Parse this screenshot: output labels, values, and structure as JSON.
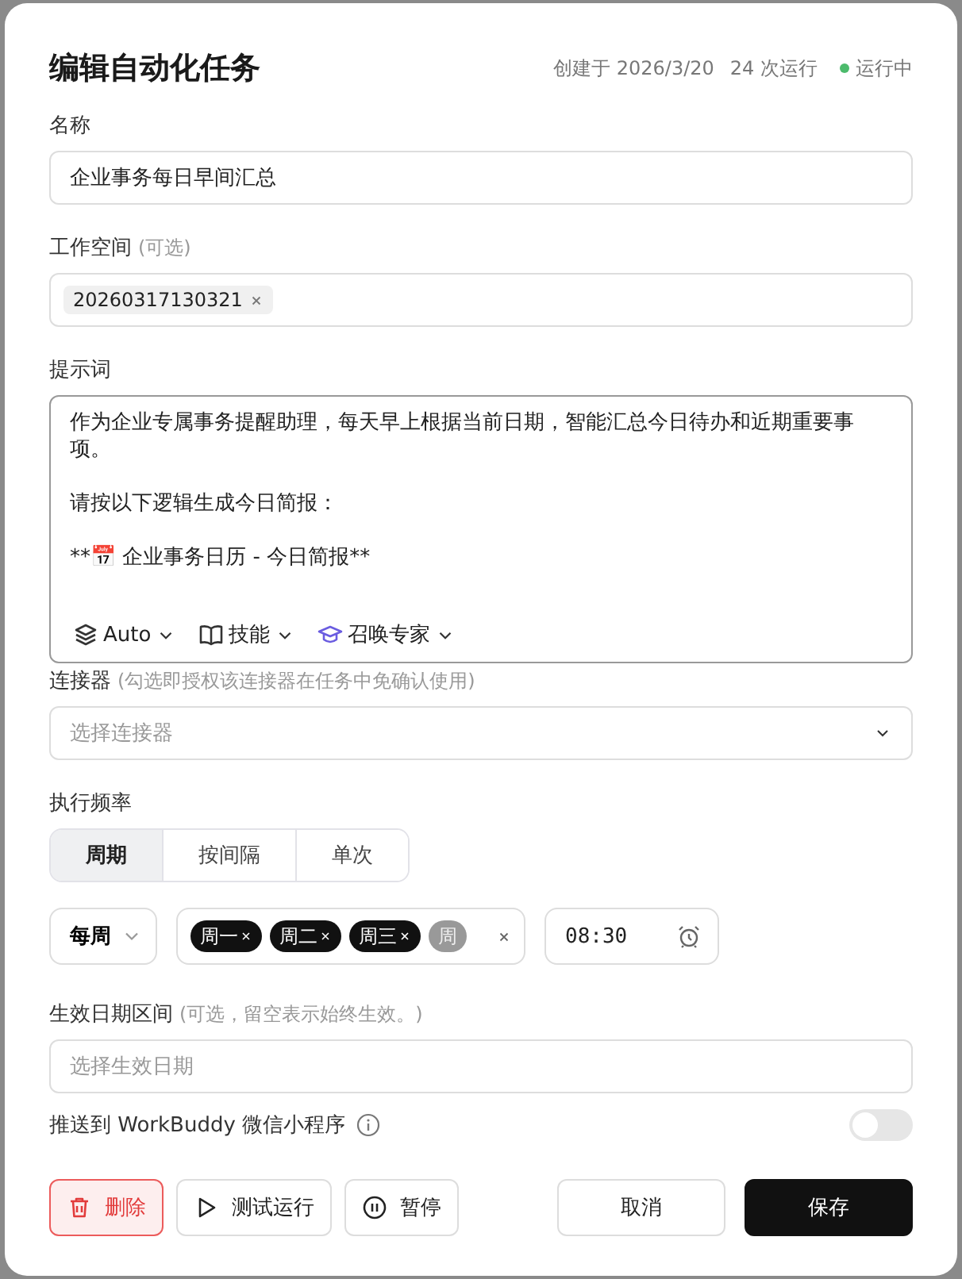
{
  "title": "编辑自动化任务",
  "meta": {
    "created": "创建于 2026/3/20",
    "runs": "24 次运行",
    "status": "运行中"
  },
  "name_field": {
    "label": "名称",
    "value": "企业事务每日早间汇总"
  },
  "workspace": {
    "label": "工作空间",
    "hint": "(可选)",
    "tags": [
      "20260317130321"
    ]
  },
  "prompt": {
    "label": "提示词",
    "paragraphs": [
      "作为企业专属事务提醒助理，每天早上根据当前日期，智能汇总今日待办和近期重要事项。",
      "请按以下逻辑生成今日简报：",
      "**📅 企业事务日历 - 今日简报**"
    ],
    "tools": [
      {
        "kind": "layers",
        "label": "Auto"
      },
      {
        "kind": "book",
        "label": "技能"
      },
      {
        "kind": "expert",
        "label": "召唤专家"
      }
    ]
  },
  "connector": {
    "label": "连接器",
    "hint": "(勾选即授权该连接器在任务中免确认使用)",
    "placeholder": "选择连接器"
  },
  "frequency": {
    "label": "执行频率",
    "tabs": [
      {
        "label": "周期",
        "selected": true
      },
      {
        "label": "按间隔",
        "selected": false
      },
      {
        "label": "单次",
        "selected": false
      }
    ],
    "period": "每周",
    "days": [
      {
        "label": "周一",
        "faded": false
      },
      {
        "label": "周二",
        "faded": false
      },
      {
        "label": "周三",
        "faded": false
      },
      {
        "label": "周",
        "faded": true
      }
    ],
    "time": "08:30"
  },
  "date_range": {
    "label": "生效日期区间",
    "hint": "(可选，留空表示始终生效。)",
    "placeholder": "选择生效日期"
  },
  "push": {
    "label": "推送到 WorkBuddy 微信小程序",
    "on": false
  },
  "buttons": [
    {
      "kind": "delete",
      "label": "删除"
    },
    {
      "kind": "test",
      "label": "测试运行"
    },
    {
      "kind": "pause",
      "label": "暂停"
    },
    {
      "kind": "cancel",
      "label": "取消"
    },
    {
      "kind": "save",
      "label": "保存"
    }
  ]
}
